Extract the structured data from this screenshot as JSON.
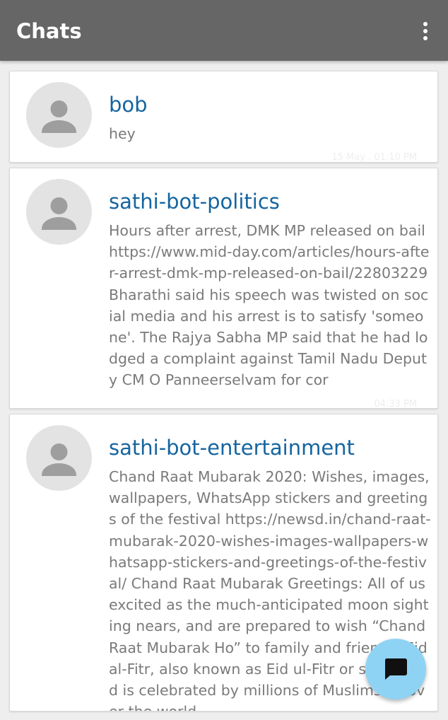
{
  "appbar": {
    "title": "Chats",
    "menu_icon": "more-vert-icon"
  },
  "chats": [
    {
      "name": "bob",
      "preview": "hey",
      "time": "15 May , 01:10 PM",
      "avatar_icon": "person-icon"
    },
    {
      "name": "sathi-bot-politics",
      "preview": "Hours after arrest, DMK MP released on bail https://www.mid-day.com/articles/hours-after-arrest-dmk-mp-released-on-bail/22803229 Bharathi said his speech was twisted on social media and his arrest is to satisfy 'someone'. The Rajya Sabha MP said that he had lodged a complaint against Tamil Nadu Deputy CM O Panneerselvam for cor",
      "time": "04:33 PM",
      "avatar_icon": "person-icon"
    },
    {
      "name": "sathi-bot-entertainment",
      "preview": "Chand Raat Mubarak 2020: Wishes, images, wallpapers, WhatsApp stickers and greetings of the festival https://newsd.in/chand-raat-mubarak-2020-wishes-images-wallpapers-whatsapp-stickers-and-greetings-of-the-festival/ Chand Raat Mubarak Greetings: All of us excited as the much-anticipated moon sighting nears, and are prepared to wish “Chand Raat Mubarak Ho” to family and friends. Eid al-Fitr, also known as Eid ul-Fitr or simply Eid is celebrated by millions of Muslims all over the world",
      "avatar_icon": "person-icon"
    }
  ],
  "fab": {
    "icon": "chat-icon"
  },
  "colors": {
    "appbar": "#666666",
    "background": "#eeeeee",
    "chat_name": "#1565a0",
    "preview_text": "#7a7a7a",
    "fab": "#8fd3f4"
  }
}
